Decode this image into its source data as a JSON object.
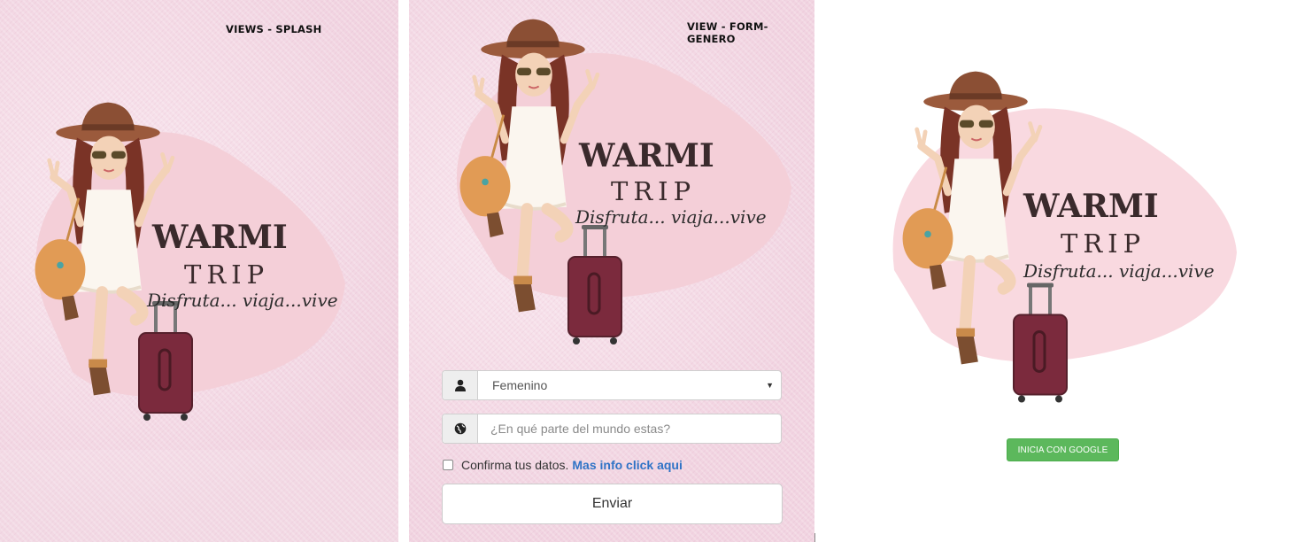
{
  "splash": {
    "title": "VIEWS - SPLASH",
    "logo": {
      "brand": "WARMI",
      "sub": "TRIP",
      "tagline": "Disfruta... viaja...vive"
    }
  },
  "form_genero": {
    "title": "VIEW - FORM-GENERO",
    "logo": {
      "brand": "WARMI",
      "sub": "TRIP",
      "tagline": "Disfruta... viaja...vive"
    },
    "gender_select": {
      "value": "Femenino",
      "icon": "user-icon"
    },
    "location_input": {
      "placeholder": "¿En qué parte del mundo estas?",
      "icon": "globe-icon"
    },
    "confirm": {
      "label": "Confirma tus datos.",
      "link": "Mas info click aqui",
      "checked": false
    },
    "submit_label": "Enviar"
  },
  "login": {
    "logo": {
      "brand": "WARMI",
      "sub": "TRIP",
      "tagline": "Disfruta... viaja...vive"
    },
    "google_button": "INICIA CON GOOGLE"
  },
  "colors": {
    "pink_bg": "#f5dfe9",
    "blob": "#f4cfd8",
    "google_green": "#5cb85c",
    "link_blue": "#2f73c6"
  }
}
